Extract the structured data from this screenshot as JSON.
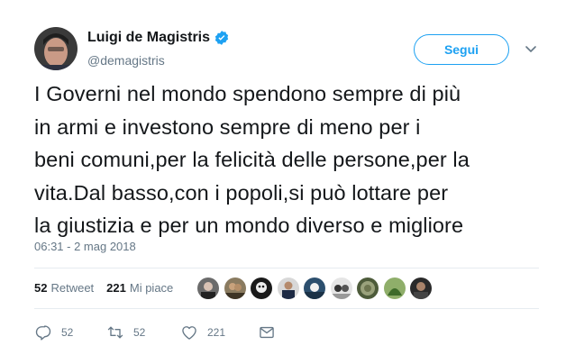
{
  "author": {
    "display_name": "Luigi de Magistris",
    "handle": "@demagistris",
    "verified": true
  },
  "follow_label": "Segui",
  "tweet_text": "I Governi nel mondo spendono sempre di più\nin armi e investono sempre di meno per i\nbeni comuni,per la felicità delle persone,per la\nvita.Dal basso,con i popoli,si può lottare per\nla giustizia e per un mondo diverso e migliore",
  "timestamp": "06:31 - 2 mag 2018",
  "stats": {
    "retweet_count": "52",
    "retweet_label": "Retweet",
    "like_count": "221",
    "like_label": "Mi piace"
  },
  "likers_count_shown": 9,
  "actions": {
    "reply_count": "52",
    "retweet_count": "52",
    "like_count": "221"
  },
  "colors": {
    "accent": "#1da1f2",
    "text": "#14171a",
    "secondary": "#657786",
    "divider": "#e6ecf0"
  }
}
